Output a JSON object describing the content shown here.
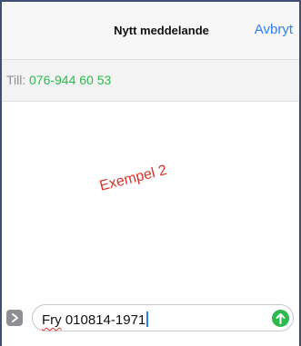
{
  "header": {
    "title": "Nytt meddelande",
    "cancel_label": "Avbryt"
  },
  "recipient": {
    "label": "Till:",
    "value": "076-944 60 53"
  },
  "annotation": {
    "text": "Exempel 2"
  },
  "composer": {
    "misspelled_word": "Fry",
    "rest_text": " 010814-1971",
    "apps_icon": "chevron-right-icon",
    "send_icon": "arrow-up-icon"
  },
  "colors": {
    "accent_blue": "#2a7ff6",
    "green": "#2db94d",
    "annotation_red": "#e0312a",
    "frame": "#3d4f73"
  }
}
